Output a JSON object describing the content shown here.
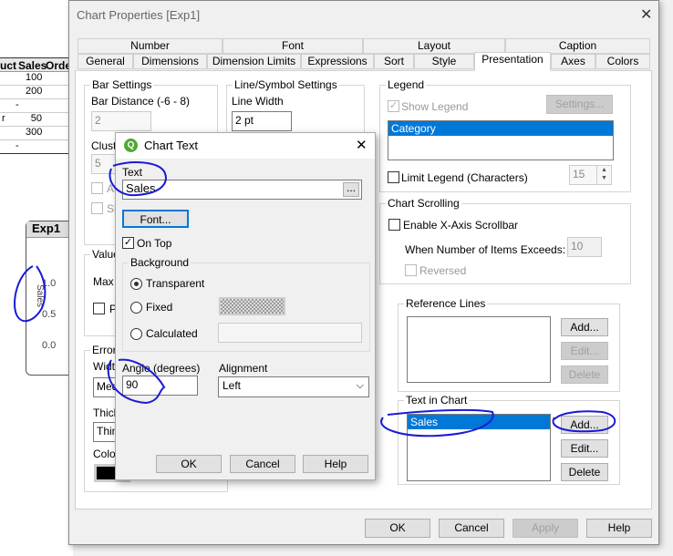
{
  "background_app": {
    "table_headers": [
      "uct",
      "Sales",
      "Orde"
    ],
    "rows": [
      {
        "col1": "",
        "sales": "100"
      },
      {
        "col1": "",
        "sales": "200"
      },
      {
        "col1": "",
        "sales": "-"
      },
      {
        "col1": "r",
        "sales": "50"
      },
      {
        "col1": "",
        "sales": "300"
      },
      {
        "col1": "",
        "sales": "-"
      }
    ],
    "chart_title": "Exp1",
    "axis_label": "Sales",
    "y_ticks": [
      "1.0",
      "0.5",
      "0.0"
    ]
  },
  "dialog": {
    "title": "Chart Properties [Exp1]",
    "tabs_row1": [
      "Number",
      "Font",
      "Layout",
      "Caption"
    ],
    "tabs_row2": [
      "General",
      "Dimensions",
      "Dimension Limits",
      "Expressions",
      "Sort",
      "Style",
      "Presentation",
      "Axes",
      "Colors"
    ],
    "selected_tab": "Presentation",
    "bar_settings": {
      "label": "Bar Settings",
      "bar_distance_label": "Bar Distance (-6 - 8)",
      "bar_distance": "2",
      "cluster_label": "Cluste",
      "cluster": "5",
      "check1": "Al",
      "check2": "Sh"
    },
    "line_symbol": {
      "label": "Line/Symbol Settings",
      "line_width_label": "Line Width",
      "line_width": "2 pt"
    },
    "values_group": {
      "label": "Value",
      "max_label": "Max V",
      "plot_label": "Pl"
    },
    "error_group": {
      "label": "Error",
      "width_label": "Width",
      "width": "Med",
      "thick_label": "Thick",
      "thick": "Thin",
      "color_label": "Color"
    },
    "legend": {
      "label": "Legend",
      "show_legend": "Show Legend",
      "settings": "Settings...",
      "items": [
        "Category"
      ],
      "limit_label": "Limit Legend (Characters)",
      "limit": "15"
    },
    "scrolling": {
      "label": "Chart Scrolling",
      "enable": "Enable X-Axis Scrollbar",
      "exceeds_label": "When Number of Items Exceeds:",
      "exceeds": "10",
      "reversed": "Reversed"
    },
    "reference_lines": {
      "label": "Reference Lines",
      "add": "Add...",
      "edit": "Edit...",
      "delete": "Delete"
    },
    "text_in_chart": {
      "label": "Text in Chart",
      "items": [
        "Sales"
      ],
      "add": "Add...",
      "edit": "Edit...",
      "delete": "Delete"
    },
    "buttons": {
      "ok": "OK",
      "cancel": "Cancel",
      "apply": "Apply",
      "help": "Help"
    }
  },
  "chart_text": {
    "title": "Chart Text",
    "text_label": "Text",
    "text_value": "Sales",
    "browse": "...",
    "font_button": "Font...",
    "on_top": "On Top",
    "background_label": "Background",
    "transparent": "Transparent",
    "fixed": "Fixed",
    "calculated": "Calculated",
    "selected_background": "Transparent",
    "angle_label": "Angle (degrees)",
    "angle_value": "90",
    "alignment_label": "Alignment",
    "alignment_value": "Left",
    "ok": "OK",
    "cancel": "Cancel",
    "help": "Help"
  },
  "colors": {
    "selection": "#0078d7",
    "annotation_ink": "#1a1ad6"
  }
}
